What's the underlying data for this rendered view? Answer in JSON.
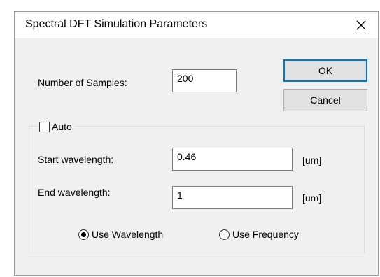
{
  "window": {
    "title": "Spectral DFT Simulation Parameters",
    "close_icon": "close-icon"
  },
  "buttons": {
    "ok_label": "OK",
    "cancel_label": "Cancel"
  },
  "samples": {
    "label": "Number of Samples:",
    "value": "200"
  },
  "auto": {
    "label": "Auto",
    "checked": false
  },
  "start": {
    "label": "Start wavelength:",
    "value": "0.46",
    "unit": "[um]"
  },
  "end": {
    "label": "End wavelength:",
    "value": "1",
    "unit": "[um]"
  },
  "mode": {
    "wavelength_label": "Use Wavelength",
    "frequency_label": "Use Frequency",
    "selected": "wavelength"
  },
  "colors": {
    "accent": "#0078d7",
    "dialog_bg": "#f0f0f0"
  }
}
